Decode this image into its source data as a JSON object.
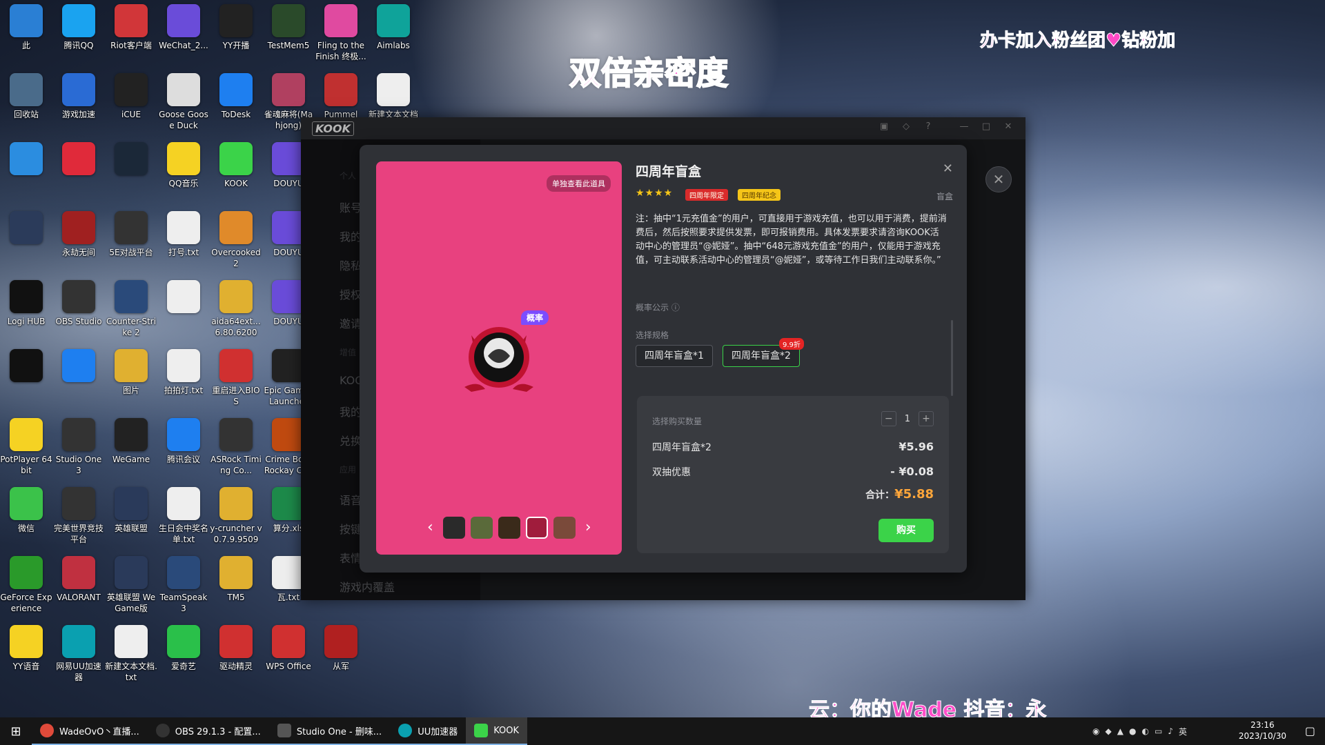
{
  "overlay": {
    "top_center": "双倍亲密度",
    "top_right": "办卡加入粉丝团♥钻粉加",
    "bottom": "云：你的Wade 抖音：永"
  },
  "desktop_icons": [
    {
      "label": "此",
      "color": "#2a7fd4"
    },
    {
      "label": "腾讯QQ",
      "color": "#1aa3f0"
    },
    {
      "label": "Riot客户端",
      "color": "#d13639"
    },
    {
      "label": "WeChat_2...",
      "color": "#6a4cd9"
    },
    {
      "label": "YY开播",
      "color": "#222"
    },
    {
      "label": "TestMem5",
      "color": "#2a4a2a"
    },
    {
      "label": "Fling to the Finish 终极...",
      "color": "#e04aa0"
    },
    {
      "label": "Aimlabs",
      "color": "#0fa39a"
    },
    {
      "label": "回收站",
      "color": "#4a6b8a"
    },
    {
      "label": "游戏加速",
      "color": "#2a6bd4"
    },
    {
      "label": "iCUE",
      "color": "#222"
    },
    {
      "label": "Goose Goose Duck",
      "color": "#ddd"
    },
    {
      "label": "ToDesk",
      "color": "#1e7ff0"
    },
    {
      "label": "雀魂麻将(Mahjong)",
      "color": "#b04060"
    },
    {
      "label": "Pummel",
      "color": "#c03030"
    },
    {
      "label": "新建文本文档",
      "color": "#eee"
    },
    {
      "label": "",
      "color": "#2b8de0"
    },
    {
      "label": "",
      "color": "#e02a3a"
    },
    {
      "label": "",
      "color": "#1b2838"
    },
    {
      "label": "QQ音乐",
      "color": "#f5d223"
    },
    {
      "label": "KOOK",
      "color": "#3bd349"
    },
    {
      "label": "DOUYU",
      "color": "#6a4cd9"
    },
    {
      "label": "",
      "color": "#2b3b5a"
    },
    {
      "label": "永劫无间",
      "color": "#a02020"
    },
    {
      "label": "5E对战平台",
      "color": "#333"
    },
    {
      "label": "打号.txt",
      "color": "#eee"
    },
    {
      "label": "Overcooked 2",
      "color": "#e08a2a"
    },
    {
      "label": "DOUYU",
      "color": "#6a4cd9"
    },
    {
      "label": "Logi HUB",
      "color": "#111"
    },
    {
      "label": "OBS Studio",
      "color": "#333"
    },
    {
      "label": "Counter-Strike 2",
      "color": "#2a4a7a"
    },
    {
      "label": "",
      "color": "#eee"
    },
    {
      "label": "aida64ext... 6.80.6200",
      "color": "#e0b030"
    },
    {
      "label": "DOUYU",
      "color": "#6a4cd9"
    },
    {
      "label": "",
      "color": "#111"
    },
    {
      "label": "",
      "color": "#1e7ff0"
    },
    {
      "label": "图片",
      "color": "#e0b030"
    },
    {
      "label": "拍拍灯.txt",
      "color": "#eee"
    },
    {
      "label": "重启进入BIOS",
      "color": "#d03030"
    },
    {
      "label": "Epic Games Launcher",
      "color": "#222"
    },
    {
      "label": "PotPlayer 64 bit",
      "color": "#f5d223"
    },
    {
      "label": "Studio One 3",
      "color": "#333"
    },
    {
      "label": "WeGame",
      "color": "#222"
    },
    {
      "label": "腾讯会议",
      "color": "#1e7ff0"
    },
    {
      "label": "ASRock Timing Co...",
      "color": "#333"
    },
    {
      "label": "Crime Boss Rockay City",
      "color": "#c04a10"
    },
    {
      "label": "微信",
      "color": "#3bc24a"
    },
    {
      "label": "完美世界竞技平台",
      "color": "#333"
    },
    {
      "label": "英雄联盟",
      "color": "#2a3a5a"
    },
    {
      "label": "生日会中奖名单.txt",
      "color": "#eee"
    },
    {
      "label": "y-cruncher v0.7.9.9509",
      "color": "#e0b030"
    },
    {
      "label": "算分.xls",
      "color": "#1d8a4a"
    },
    {
      "label": "GeForce Experience",
      "color": "#2a9a2a"
    },
    {
      "label": "VALORANT",
      "color": "#c03040"
    },
    {
      "label": "英雄联盟 WeGame版",
      "color": "#2a3a5a"
    },
    {
      "label": "TeamSpeak 3",
      "color": "#2a4a7a"
    },
    {
      "label": "TM5",
      "color": "#e0b030"
    },
    {
      "label": "瓦.txt",
      "color": "#eee"
    },
    {
      "label": "YY语音",
      "color": "#f5d223"
    },
    {
      "label": "网易UU加速器",
      "color": "#0aa0b0"
    },
    {
      "label": "新建文本文档.txt",
      "color": "#eee"
    },
    {
      "label": "爱奇艺",
      "color": "#2ac04a"
    },
    {
      "label": "驱动精灵",
      "color": "#d03030"
    },
    {
      "label": "WPS Office",
      "color": "#d03030"
    },
    {
      "label": "从军",
      "color": "#b02020"
    }
  ],
  "app": {
    "logo": "KOOK",
    "sidebar_items": [
      "个人",
      "账号",
      "我的",
      "隐私",
      "授权",
      "邀请",
      "增值",
      "KOOK",
      "我的",
      "兑换",
      "应用",
      "语音",
      "按键",
      "表情",
      "游戏内覆盖"
    ]
  },
  "modal": {
    "title": "四周年盲盒",
    "view_sep": "单独查看此道具",
    "prob_badge": "概率",
    "stars": "★★★★",
    "tag1": "四周年限定",
    "tag2": "四周年纪念",
    "category": "盲盒",
    "note": "注：抽中“1元充值金”的用户，可直接用于游戏充值，也可以用于消费，提前消费后，然后按照要求提供发票，即可报销费用。具体发票要求请咨询KOOK活动中心的管理员“@妮娅”。抽中“648元游戏充值金”的用户，仅能用于游戏充值，可主动联系活动中心的管理员“@妮娅”，或等待工作日我们主动联系你。”",
    "prob_notice": "概率公示 ⓘ",
    "spec_label": "选择规格",
    "spec1": "四周年盲盒*1",
    "spec2": "四周年盲盒*2",
    "discount": "9.9折",
    "qty_label": "选择购买数量",
    "qty": "1",
    "item_name": "四周年盲盒*2",
    "item_price": "¥5.96",
    "promo_name": "双抽优惠",
    "promo_price": "- ¥0.08",
    "total_label": "合计：",
    "total_amt": "¥5.88",
    "buy": "购买"
  },
  "taskbar": {
    "items": [
      "WadeOvO丶直播...",
      "OBS 29.1.3 - 配置...",
      "Studio One - 删味...",
      "UU加速器",
      "KOOK"
    ],
    "lang": "英",
    "time": "23:16",
    "date": "2023/10/30"
  }
}
